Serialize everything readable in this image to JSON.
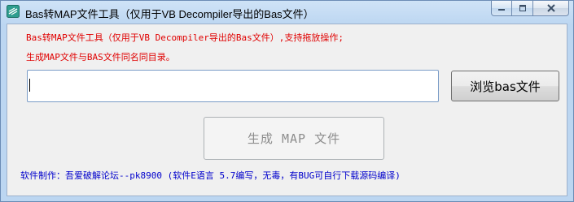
{
  "window": {
    "title": "Bas转MAP文件工具（仅用于VB Decompiler导出的Bas文件）"
  },
  "icons": {
    "app": "app-icon",
    "minimize": "minimize-icon",
    "maximize": "maximize-icon",
    "close": "close-icon"
  },
  "info": {
    "line1": "Bas转MAP文件工具（仅用于VB Decompiler导出的Bas文件）,支持拖放操作;",
    "line2": "生成MAP文件与BAS文件同名同目录。"
  },
  "path_input": {
    "value": "",
    "placeholder": ""
  },
  "buttons": {
    "browse": "浏览bas文件",
    "generate": "生成 MAP 文件"
  },
  "footer": {
    "credit": "软件制作：吾爱破解论坛--pk8900 (软件E语言 5.7编写，无毒，有BUG可自行下载源码编译)"
  },
  "colors": {
    "info_text": "#e00000",
    "footer_text": "#0000cc",
    "disabled_text": "#8d8d8d"
  }
}
